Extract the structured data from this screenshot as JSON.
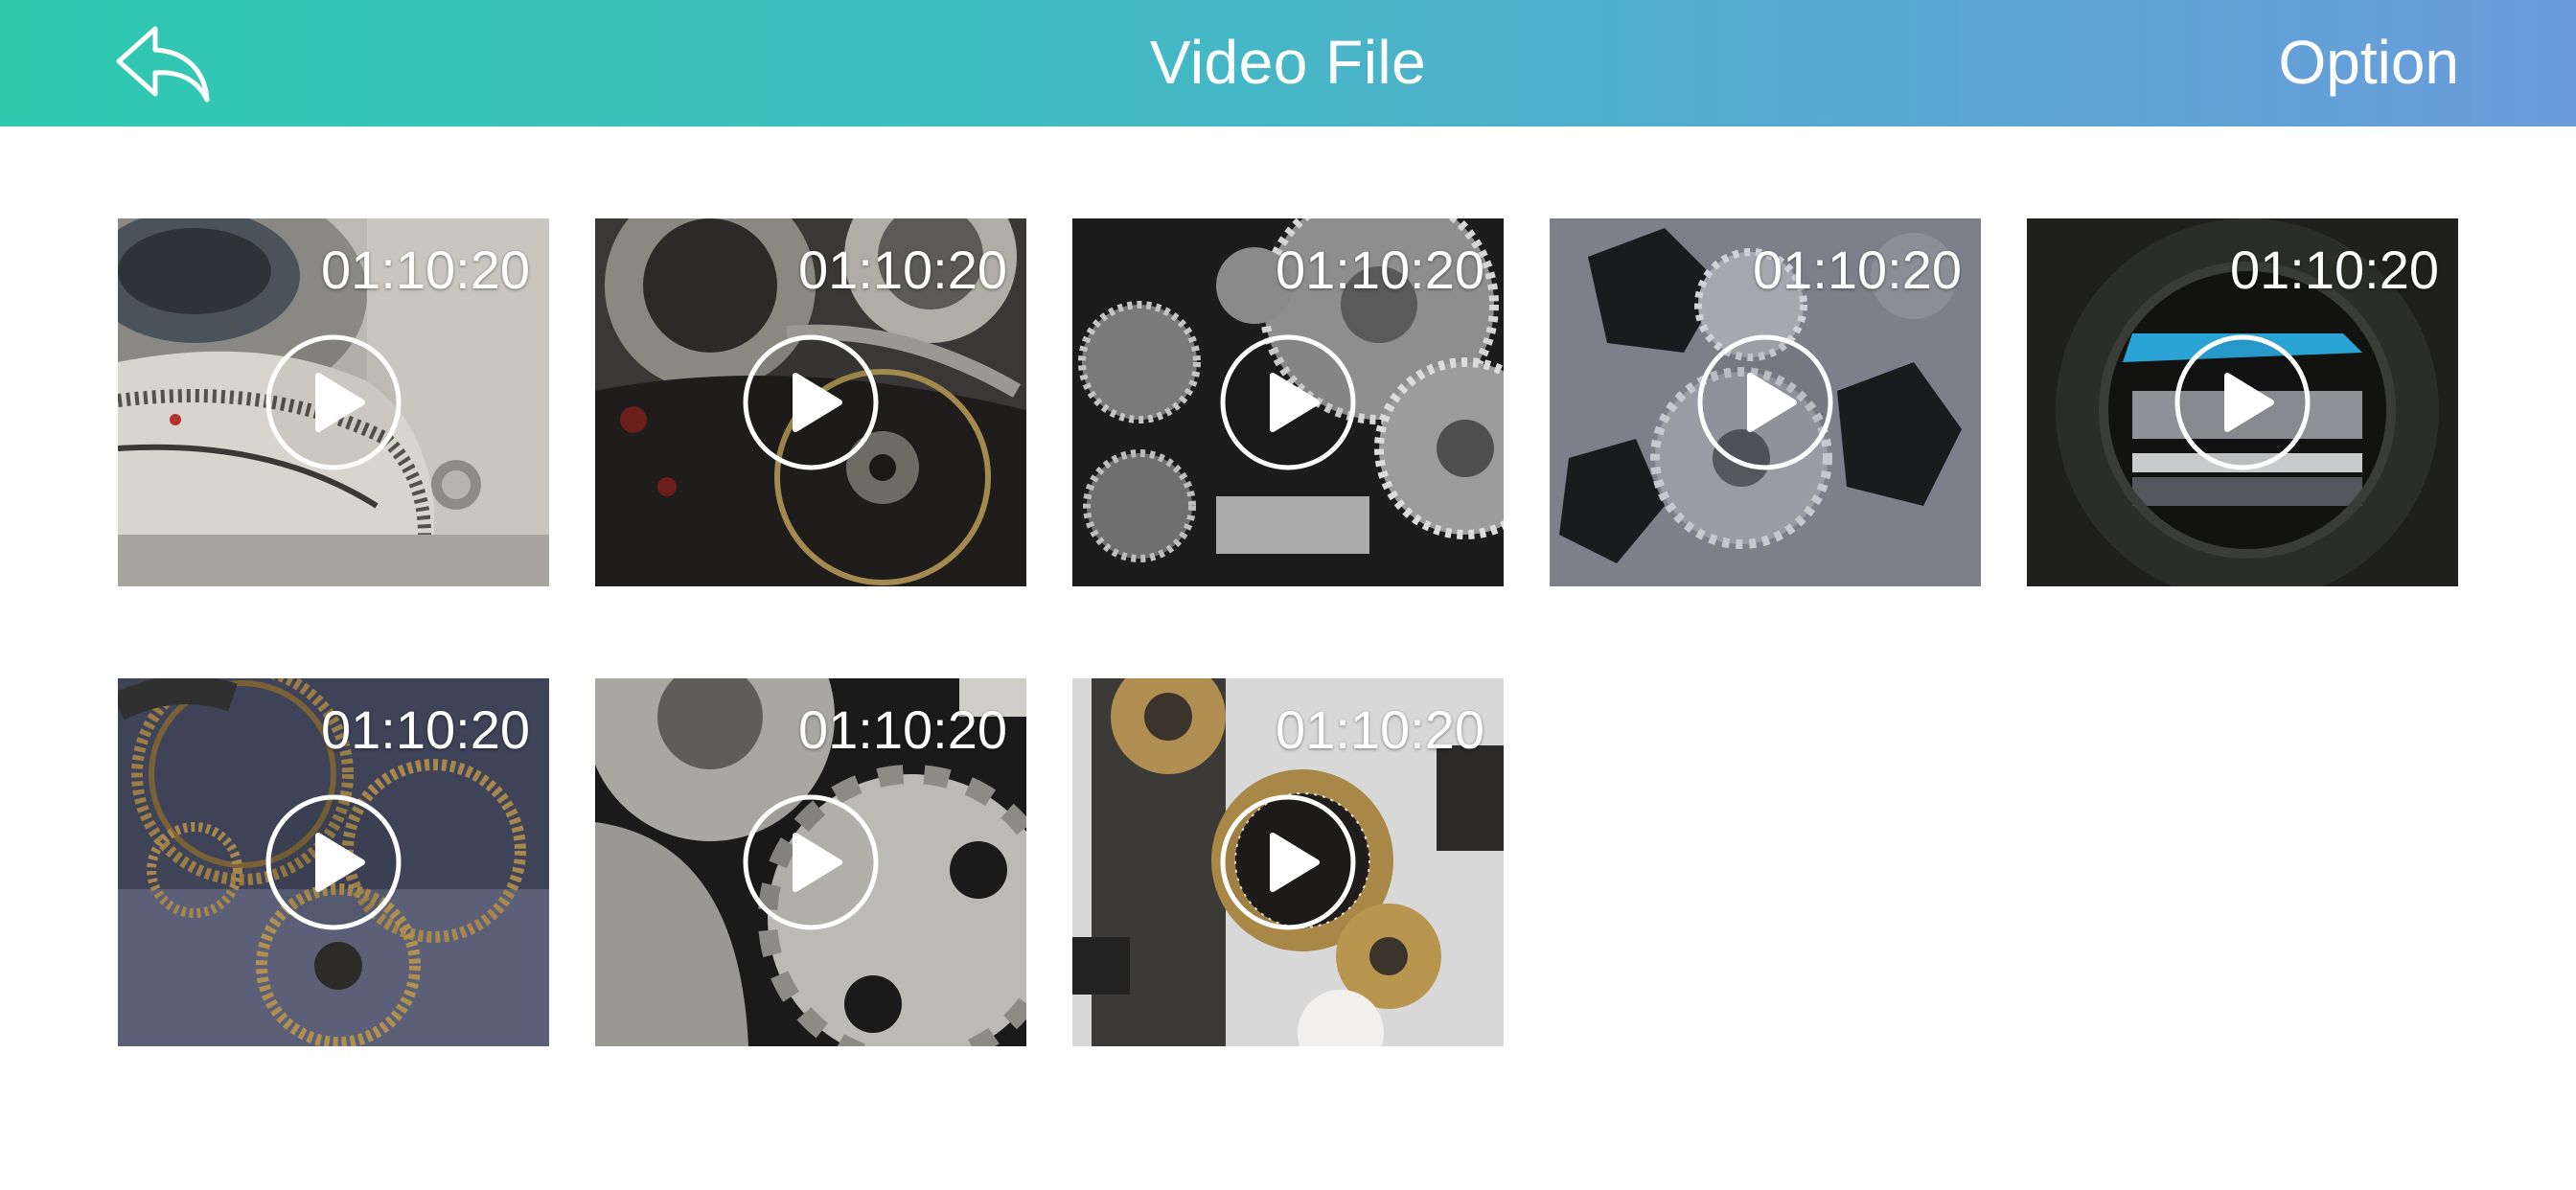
{
  "header": {
    "title": "Video File",
    "option_label": "Option",
    "back_icon": "back-arrow-icon",
    "gradient": [
      "#2fc9b0",
      "#6a9cdc"
    ]
  },
  "videos": [
    {
      "duration": "01:10:20",
      "theme": "camera-lens-dial"
    },
    {
      "duration": "01:10:20",
      "theme": "watch-movement"
    },
    {
      "duration": "01:10:20",
      "theme": "machine-gears"
    },
    {
      "duration": "01:10:20",
      "theme": "metal-gear-plate"
    },
    {
      "duration": "01:10:20",
      "theme": "camera-lens-interior"
    },
    {
      "duration": "01:10:20",
      "theme": "brass-clock-gears"
    },
    {
      "duration": "01:10:20",
      "theme": "steel-gear-closeup"
    },
    {
      "duration": "01:10:20",
      "theme": "vintage-dial-mechanism"
    }
  ]
}
